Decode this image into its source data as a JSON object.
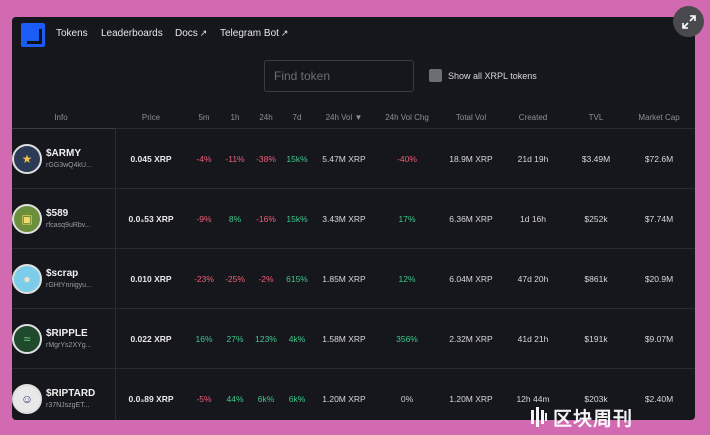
{
  "nav": {
    "links": [
      {
        "label": "Tokens",
        "external": false
      },
      {
        "label": "Leaderboards",
        "external": false
      },
      {
        "label": "Docs",
        "external": true
      },
      {
        "label": "Telegram Bot",
        "external": true
      }
    ],
    "external_arrow": "↗"
  },
  "search": {
    "placeholder": "Find token",
    "value": ""
  },
  "filter": {
    "show_all_label": "Show all XRPL tokens",
    "checked": false
  },
  "table": {
    "columns": [
      "Info",
      "Price",
      "5m",
      "1h",
      "24h",
      "7d",
      "24h Vol ▼",
      "24h Vol Chg",
      "Total Vol",
      "Created",
      "TVL",
      "Market Cap"
    ],
    "rows": [
      {
        "symbol": "$ARMY",
        "address": "rGG3wQ4kU...",
        "price": "0.045 XRP",
        "m5": "-4%",
        "h1": "-11%",
        "h24": "-38%",
        "d7": "15k%",
        "vol24": "5.47M XRP",
        "volchg": "-40%",
        "total": "18.9M XRP",
        "created": "21d 19h",
        "tvl": "$3.49M",
        "mcap": "$72.6M",
        "avatar_icon": "army-star-icon",
        "avatar_color": "#2b3a55"
      },
      {
        "symbol": "$589",
        "address": "rfcasq9uRbv...",
        "price": "0.0₃53 XRP",
        "m5": "-9%",
        "h1": "8%",
        "h24": "-16%",
        "d7": "15k%",
        "vol24": "3.43M XRP",
        "volchg": "17%",
        "total": "6.36M XRP",
        "created": "1d 16h",
        "tvl": "$252k",
        "mcap": "$7.74M",
        "avatar_icon": "pixel-character-icon",
        "avatar_color": "#6b8f3a"
      },
      {
        "symbol": "$scrap",
        "address": "rGHtYnnigyu...",
        "price": "0.010 XRP",
        "m5": "-23%",
        "h1": "-25%",
        "h24": "-2%",
        "d7": "615%",
        "vol24": "1.85M XRP",
        "volchg": "12%",
        "total": "6.04M XRP",
        "created": "47d 20h",
        "tvl": "$861k",
        "mcap": "$20.9M",
        "avatar_icon": "dog-face-icon",
        "avatar_color": "#7ccdea"
      },
      {
        "symbol": "$RIPPLE",
        "address": "rMgrYs2XYg...",
        "price": "0.022 XRP",
        "m5": "16%",
        "h1": "27%",
        "h24": "123%",
        "d7": "4k%",
        "vol24": "1.58M XRP",
        "volchg": "356%",
        "total": "2.32M XRP",
        "created": "41d 21h",
        "tvl": "$191k",
        "mcap": "$9.07M",
        "avatar_icon": "ripple-wordmark-icon",
        "avatar_color": "#1f4a2c"
      },
      {
        "symbol": "$RIPTARD",
        "address": "r37NJszgET...",
        "price": "0.0₃89 XRP",
        "m5": "-5%",
        "h1": "44%",
        "h24": "6k%",
        "d7": "6k%",
        "vol24": "1.20M XRP",
        "volchg": "0%",
        "total": "1.20M XRP",
        "created": "12h 44m",
        "tvl": "$203k",
        "mcap": "$2.40M",
        "avatar_icon": "face-30-icon",
        "avatar_color": "#e8e8e8"
      }
    ]
  },
  "watermark": {
    "text": "区块周刊"
  },
  "colors": {
    "negative": "#ef5f77",
    "positive": "#3ec98a",
    "accent": "#1a5cf5",
    "background": "#16171d",
    "page": "#d16ab0"
  }
}
